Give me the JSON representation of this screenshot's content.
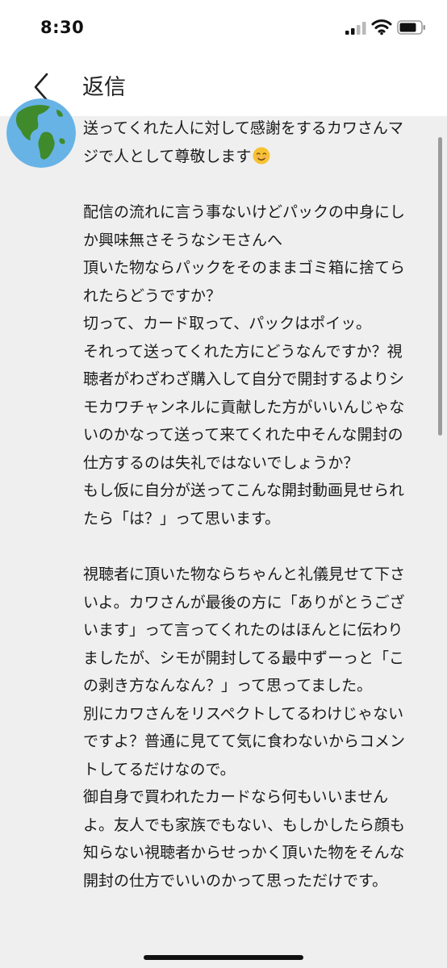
{
  "status": {
    "time": "8:30"
  },
  "header": {
    "title": "返信"
  },
  "comment": {
    "para1": [
      "送ってくれた人に対して感謝をするカワさんマ",
      "ジで人として尊敬します"
    ],
    "para2": [
      "配信の流れに言う事ないけどパックの中身にし",
      "か興味無さそうなシモさんへ",
      "頂いた物ならパックをそのままゴミ箱に捨てら",
      "れたらどうですか？",
      "切って、カード取って、パックはポイッ。",
      "それって送ってくれた方にどうなんですか？視",
      "聴者がわざわざ購入して自分で開封するよりシ",
      "モカワチャンネルに貢献した方がいいんじゃな",
      "いのかなって送って来てくれた中そんな開封の",
      "仕方するのは失礼ではないでしょうか？",
      "もし仮に自分が送ってこんな開封動画見せられ",
      "たら「は？」って思います。"
    ],
    "para3": [
      "視聴者に頂いた物ならちゃんと礼儀見せて下さ",
      "いよ。カワさんが最後の方に「ありがとうござ",
      "います」って言ってくれたのはほんとに伝わり",
      "ましたが、シモが開封してる最中ずーっと「こ",
      "の剥き方なんなん？」って思ってました。",
      "別にカワさんをリスペクトしてるわけじゃない",
      "ですよ？普通に見てて気に食わないからコメン",
      "トしてるだけなので。",
      "御自身で買われたカードなら何もいいません",
      "よ。友人でも家族でもない、もしかしたら顔も",
      "知らない視聴者からせっかく頂いた物をそんな",
      "開封の仕方でいいのかって思っただけです。"
    ]
  },
  "colors": {
    "background": "#efefef",
    "text": "#1a1a1a",
    "accent": "#3b8fd6"
  },
  "icons": {
    "back": "chevron-left-icon",
    "avatar": "globe-icon",
    "emoji": "smiling-face-emoji"
  }
}
